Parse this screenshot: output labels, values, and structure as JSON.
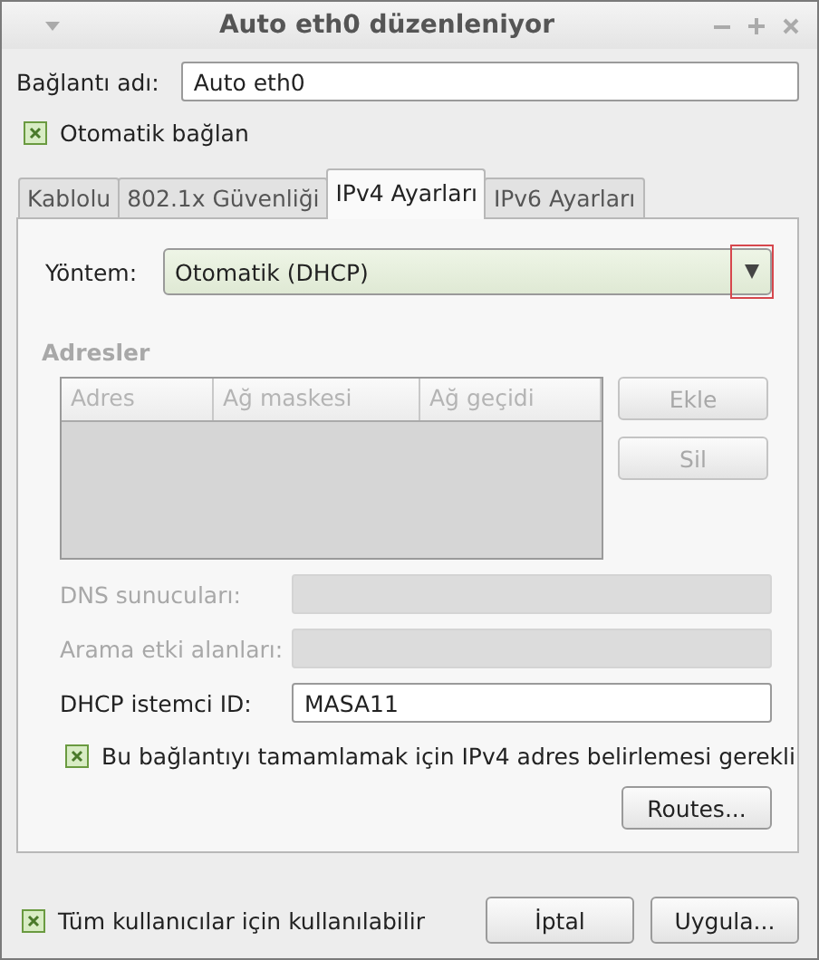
{
  "window": {
    "title": "Auto eth0 düzenleniyor"
  },
  "connection_name": {
    "label": "Bağlantı adı:",
    "value": "Auto eth0"
  },
  "auto_connect": {
    "label": "Otomatik bağlan",
    "checked": true
  },
  "tabs": [
    {
      "label": "Kablolu",
      "selected": false
    },
    {
      "label": "802.1x Güvenliği",
      "selected": false
    },
    {
      "label": "IPv4 Ayarları",
      "selected": true
    },
    {
      "label": "IPv6 Ayarları",
      "selected": false
    }
  ],
  "method": {
    "label": "Yöntem:",
    "value": "Otomatik (DHCP)"
  },
  "addresses": {
    "heading": "Adresler",
    "disabled": true,
    "columns": [
      "Adres",
      "Ağ maskesi",
      "Ağ geçidi"
    ],
    "buttons": [
      {
        "label": "Ekle",
        "disabled": true
      },
      {
        "label": "Sil",
        "disabled": true
      }
    ]
  },
  "fields": [
    {
      "label": "DNS sunucuları:",
      "disabled": true
    },
    {
      "label": "Arama etki alanları:",
      "disabled": true
    },
    {
      "label": "DHCP istemci ID:",
      "value": "MASA11",
      "disabled": false
    }
  ],
  "require_ipv4": {
    "label": "Bu bağlantıyı tamamlamak için IPv4 adres belirlemesi gerekli",
    "checked": true
  },
  "routes_button": "Routes...",
  "all_users": {
    "label": "Tüm kullanıcılar için kullanılabilir",
    "checked": true
  },
  "buttons": [
    "İptal",
    "Uygula..."
  ]
}
